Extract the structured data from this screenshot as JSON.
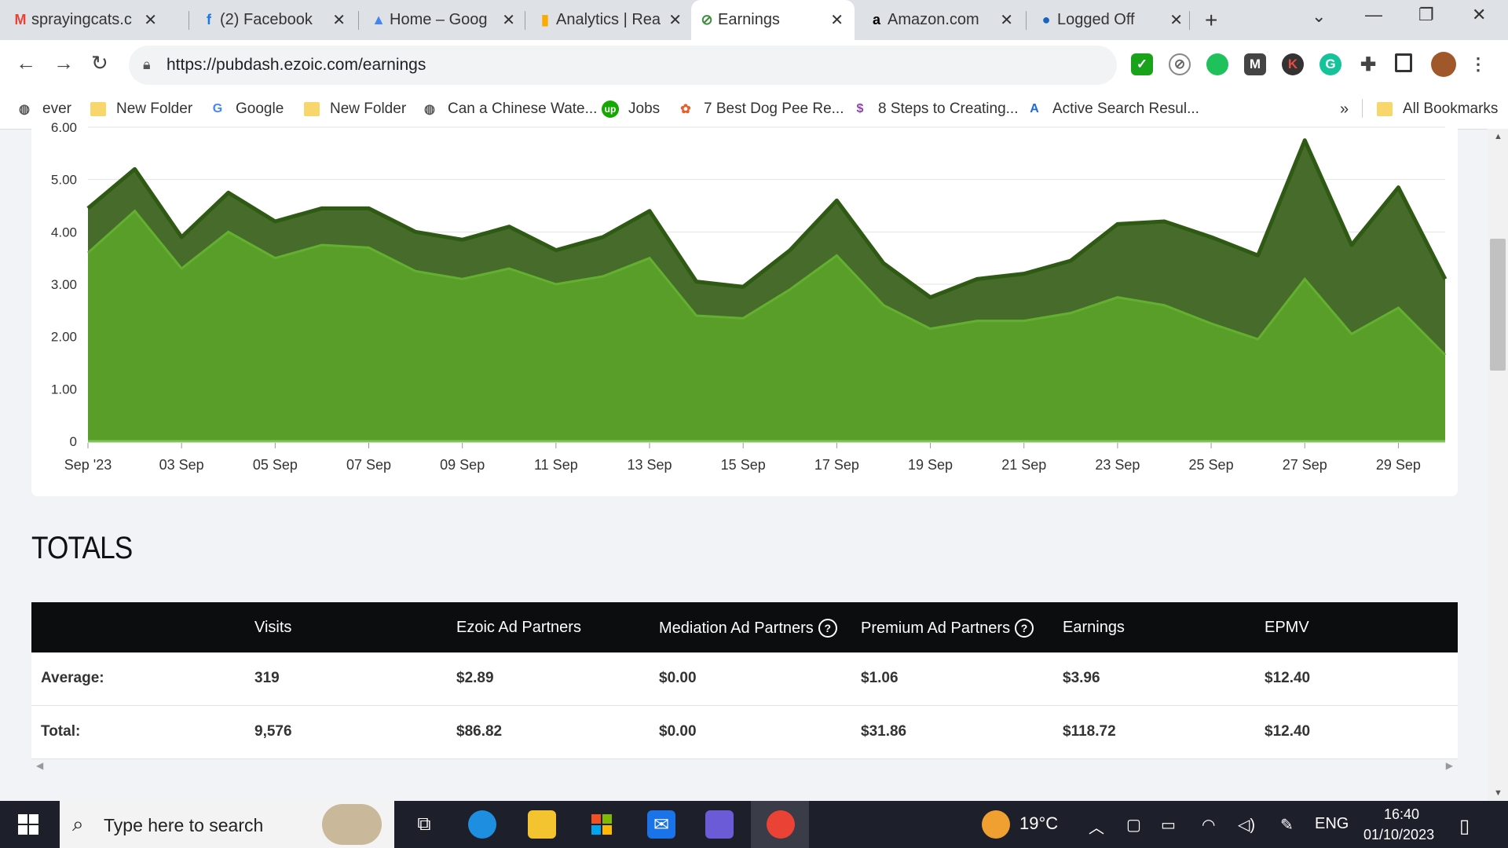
{
  "tabs": [
    {
      "title": "sprayingcats.c",
      "icon": "gmail-icon",
      "glyph": "M",
      "color": "#ea4335"
    },
    {
      "title": "(2) Facebook",
      "icon": "facebook-icon",
      "glyph": "f",
      "color": "#1877f2"
    },
    {
      "title": "Home – Goog",
      "icon": "google-ads-icon",
      "glyph": "▲",
      "color": "#4285f4"
    },
    {
      "title": "Analytics | Rea",
      "icon": "analytics-icon",
      "glyph": "▮",
      "color": "#f9ab00"
    },
    {
      "title": "Earnings",
      "icon": "ezoic-icon",
      "glyph": "⊘",
      "color": "#3c8d3c",
      "active": true
    },
    {
      "title": "Amazon.com",
      "icon": "amazon-icon",
      "glyph": "a",
      "color": "#000000"
    },
    {
      "title": "Logged Off",
      "icon": "logged-off-icon",
      "glyph": "●",
      "color": "#1565c0"
    }
  ],
  "address": {
    "url": "https://pubdash.ezoic.com/earnings"
  },
  "bookmarks": [
    {
      "label": "ever",
      "icon": "globe-icon"
    },
    {
      "label": "New Folder",
      "icon": "folder-icon"
    },
    {
      "label": "Google",
      "icon": "google-icon"
    },
    {
      "label": "New Folder",
      "icon": "folder-icon"
    },
    {
      "label": "Can a Chinese Wate...",
      "icon": "globe-icon"
    },
    {
      "label": "Jobs",
      "icon": "upwork-icon"
    },
    {
      "label": "7 Best Dog Pee Re...",
      "icon": "dog-icon"
    },
    {
      "label": "8 Steps to Creating...",
      "icon": "dollar-icon"
    },
    {
      "label": "Active Search Resul...",
      "icon": "asr-icon"
    }
  ],
  "bookmarks_overflow": "»",
  "all_bookmarks": "All Bookmarks",
  "chart_data": {
    "type": "area",
    "x": [
      "Sep '23",
      "02 Sep",
      "03 Sep",
      "04 Sep",
      "05 Sep",
      "06 Sep",
      "07 Sep",
      "08 Sep",
      "09 Sep",
      "10 Sep",
      "11 Sep",
      "12 Sep",
      "13 Sep",
      "14 Sep",
      "15 Sep",
      "16 Sep",
      "17 Sep",
      "18 Sep",
      "19 Sep",
      "20 Sep",
      "21 Sep",
      "22 Sep",
      "23 Sep",
      "24 Sep",
      "25 Sep",
      "26 Sep",
      "27 Sep",
      "28 Sep",
      "29 Sep",
      "30 Sep"
    ],
    "tick_labels": [
      "Sep '23",
      "03 Sep",
      "05 Sep",
      "07 Sep",
      "09 Sep",
      "11 Sep",
      "13 Sep",
      "15 Sep",
      "17 Sep",
      "19 Sep",
      "21 Sep",
      "23 Sep",
      "25 Sep",
      "27 Sep",
      "29 Sep"
    ],
    "y_ticks": [
      "0",
      "1.00",
      "2.00",
      "3.00",
      "4.00",
      "5.00",
      "6.00"
    ],
    "ylim": [
      0,
      6
    ],
    "stacked": true,
    "series": [
      {
        "color": "#5a9e2a",
        "values": [
          3.6,
          4.4,
          3.3,
          4.0,
          3.5,
          3.75,
          3.7,
          3.25,
          3.1,
          3.3,
          3.0,
          3.15,
          3.5,
          2.4,
          2.35,
          2.9,
          3.55,
          2.6,
          2.15,
          2.3,
          2.3,
          2.45,
          2.75,
          2.6,
          2.25,
          1.95,
          3.1,
          2.05,
          2.55,
          1.65
        ]
      },
      {
        "color": "#466b2b",
        "values": [
          0.85,
          0.8,
          0.6,
          0.75,
          0.7,
          0.7,
          0.75,
          0.75,
          0.75,
          0.8,
          0.65,
          0.75,
          0.9,
          0.65,
          0.6,
          0.75,
          1.05,
          0.8,
          0.6,
          0.8,
          0.9,
          1.0,
          1.4,
          1.6,
          1.65,
          1.6,
          2.65,
          1.7,
          2.3,
          1.45
        ]
      }
    ]
  },
  "totals": {
    "title": "TOTALS",
    "headers": [
      "Visits",
      "Ezoic Ad Partners",
      "Mediation Ad Partners",
      "Premium Ad Partners",
      "Earnings",
      "EPMV"
    ],
    "help_glyph": "?",
    "rows": [
      {
        "label": "Average:",
        "values": [
          "319",
          "$2.89",
          "$0.00",
          "$1.06",
          "$3.96",
          "$12.40"
        ]
      },
      {
        "label": "Total:",
        "values": [
          "9,576",
          "$86.82",
          "$0.00",
          "$31.86",
          "$118.72",
          "$12.40"
        ]
      }
    ]
  },
  "taskbar": {
    "search_placeholder": "Type here to search",
    "weather": "19°C",
    "language": "ENG",
    "time": "16:40",
    "date": "01/10/2023"
  }
}
